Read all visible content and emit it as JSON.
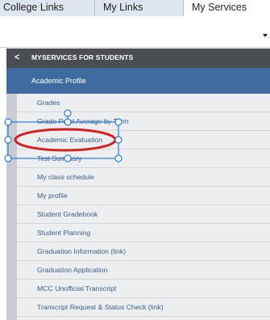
{
  "tabs": [
    {
      "label": "College Links"
    },
    {
      "label": "My Links"
    },
    {
      "label": "My Services"
    }
  ],
  "dropdown": {
    "value": ""
  },
  "menu": {
    "back_glyph": "<",
    "title": "MYSERVICES FOR STUDENTS",
    "section": "Academic Profile",
    "items": [
      {
        "label": "Grades"
      },
      {
        "label": "Grade Point Average by Term"
      },
      {
        "label": "Academic Evaluation"
      },
      {
        "label": "Test Summary"
      },
      {
        "label": "My class schedule"
      },
      {
        "label": "My profile"
      },
      {
        "label": "Student Gradebook"
      },
      {
        "label": "Student Planning"
      },
      {
        "label": "Graduation Information (link)"
      },
      {
        "label": "Graduation Application"
      },
      {
        "label": "MCC Unofficial Transcript"
      },
      {
        "label": "Transcript Request & Status Check (link)"
      }
    ]
  },
  "annotation": {
    "box_color": "#2b7bd6",
    "ellipse_color": "#d42020"
  }
}
